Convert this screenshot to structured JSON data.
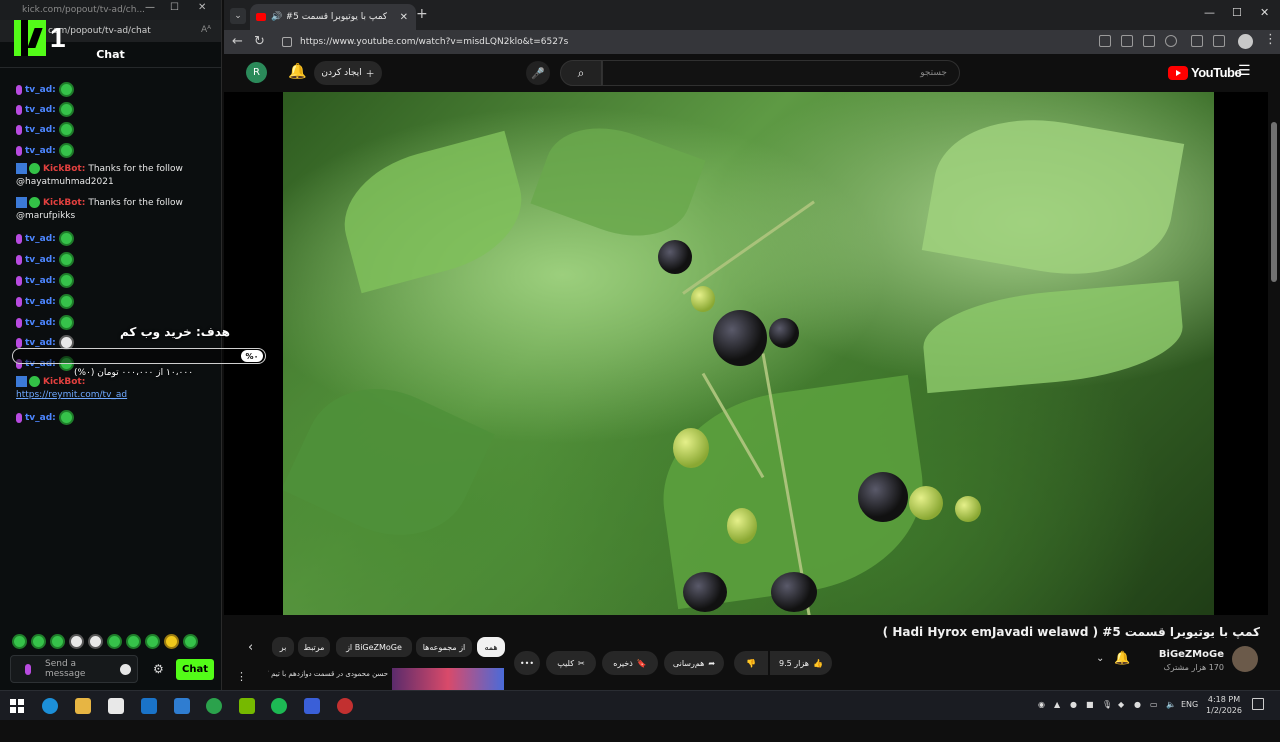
{
  "chat_window": {
    "title_url": "kick.com/popout/tv-ad/ch...",
    "address": "com/popout/tv-ad/chat",
    "header": "Chat",
    "messages": [
      {
        "user": "tv_ad",
        "type": "emote"
      },
      {
        "user": "tv_ad",
        "type": "emote"
      },
      {
        "user": "tv_ad",
        "type": "emote"
      },
      {
        "user": "tv_ad",
        "type": "emote"
      },
      {
        "user": "KickBot",
        "type": "text",
        "text": "Thanks for the follow",
        "line2": "@hayatmuhmad2021"
      },
      {
        "user": "KickBot",
        "type": "text",
        "text": "Thanks for the follow",
        "line2": "@marufpikks"
      },
      {
        "user": "tv_ad",
        "type": "emote"
      },
      {
        "user": "tv_ad",
        "type": "emote"
      },
      {
        "user": "tv_ad",
        "type": "emote"
      },
      {
        "user": "tv_ad",
        "type": "emote"
      },
      {
        "user": "tv_ad",
        "type": "emote"
      },
      {
        "user": "tv_ad",
        "type": "emote"
      },
      {
        "user": "tv_ad",
        "type": "emote"
      },
      {
        "user": "KickBot",
        "type": "link",
        "line2": "https://reymit.com/tv_ad"
      },
      {
        "user": "tv_ad",
        "type": "emote"
      }
    ],
    "goal": {
      "title": "هدف: خرید وب کم",
      "percent_label": "%۰",
      "amount_text": "۱۰،۰۰۰ از ۰۰۰،۰۰۰ تومان (۰%)",
      "progress": 0
    },
    "input_placeholder": "Send a message",
    "send_label": "Chat"
  },
  "browser": {
    "tab_title": "کمپ با یوتیوبرا قسمت 5#",
    "url": "https://www.youtube.com/watch?v=misdLQN2klo&t=6527s"
  },
  "youtube": {
    "avatar_letter": "R",
    "create_label": "ایجاد کردن",
    "search_placeholder": "جستجو",
    "logo_text": "YouTube",
    "video_title": "کمپ با یوتیوبرا قسمت 5# ( Hadi Hyrox emJavadi welawd )",
    "channel_name": "BiGeZMoGe",
    "subscribers": "170 هزار مشترک",
    "likes": "9.5 هزار",
    "share_label": "هم‌رسانی",
    "save_label": "ذخیره",
    "clip_label": "کلیپ",
    "chips": [
      "همه",
      "از مجموعه‌ها",
      "از BiGeZMoGe",
      "مرتبط",
      "بر"
    ],
    "rec_title": "حسن محمودی در قسمت دوازدهم با تیم ؟"
  },
  "taskbar": {
    "language": "ENG",
    "time": "4:18 PM",
    "date": "1/2/2026"
  }
}
